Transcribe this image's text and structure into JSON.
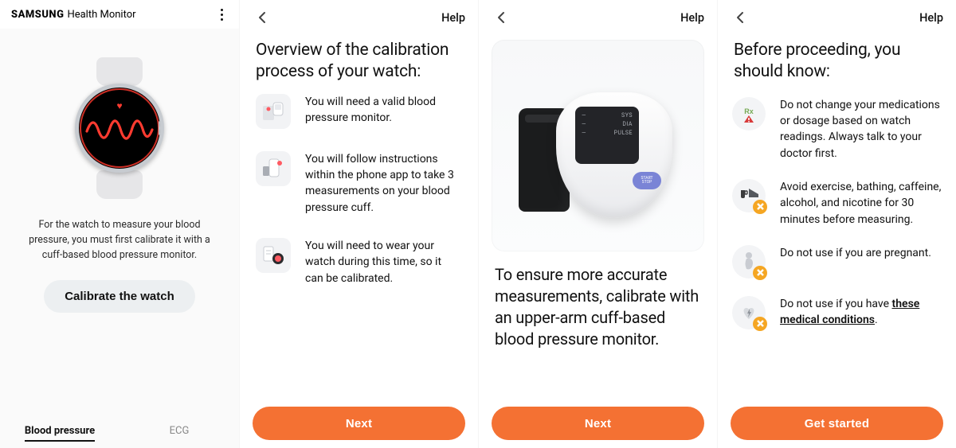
{
  "colors": {
    "accent": "#f47133",
    "heart": "#ff3b30",
    "warn": "#f5a623"
  },
  "screen1": {
    "brand_bold": "SAMSUNG",
    "brand_rest": "Health Monitor",
    "menu_icon": "kebab-menu-icon",
    "description": "For the watch to measure your blood pressure, you must first calibrate it with a cuff-based blood pressure monitor.",
    "cta": "Calibrate the watch",
    "tabs": {
      "bp": "Blood pressure",
      "ecg": "ECG",
      "active": "bp"
    }
  },
  "screen2": {
    "back_icon": "chevron-left-icon",
    "help": "Help",
    "title": "Overview of the calibration process of your watch:",
    "items": [
      {
        "icon": "bp-monitor-icon",
        "text": "You will need a valid blood pressure monitor."
      },
      {
        "icon": "phone-measure-icon",
        "text": "You will follow instructions within the phone app to take 3 measurements on your blood pressure cuff."
      },
      {
        "icon": "watch-wear-icon",
        "text": "You will need to wear your watch during this time, so it can be calibrated."
      }
    ],
    "cta": "Next"
  },
  "screen3": {
    "back_icon": "chevron-left-icon",
    "help": "Help",
    "device_screen": {
      "sys": "SYS",
      "dia": "DIA",
      "pulse": "PULSE"
    },
    "start_btn": {
      "l1": "START",
      "l2": "STOP"
    },
    "description": "To ensure more accurate measurements, calibrate with an upper-arm cuff-based blood pressure monitor.",
    "cta": "Next"
  },
  "screen4": {
    "back_icon": "chevron-left-icon",
    "help": "Help",
    "title": "Before proceeding, you should know:",
    "items": [
      {
        "icon": "rx-warning-icon",
        "badge": "alert",
        "text": "Do not change your medications or dosage based on watch readings. Always talk to your doctor first."
      },
      {
        "icon": "coffee-shoe-icon",
        "badge": "x",
        "text": "Avoid exercise, bathing, caffeine, alcohol, and nicotine for 30 minutes before measuring."
      },
      {
        "icon": "pregnant-icon",
        "badge": "x",
        "text": "Do not use if you are pregnant."
      },
      {
        "icon": "heart-bolt-icon",
        "badge": "x",
        "text_prefix": "Do not use if you have ",
        "link": "these medical conditions",
        "text_suffix": "."
      }
    ],
    "cta": "Get started"
  }
}
